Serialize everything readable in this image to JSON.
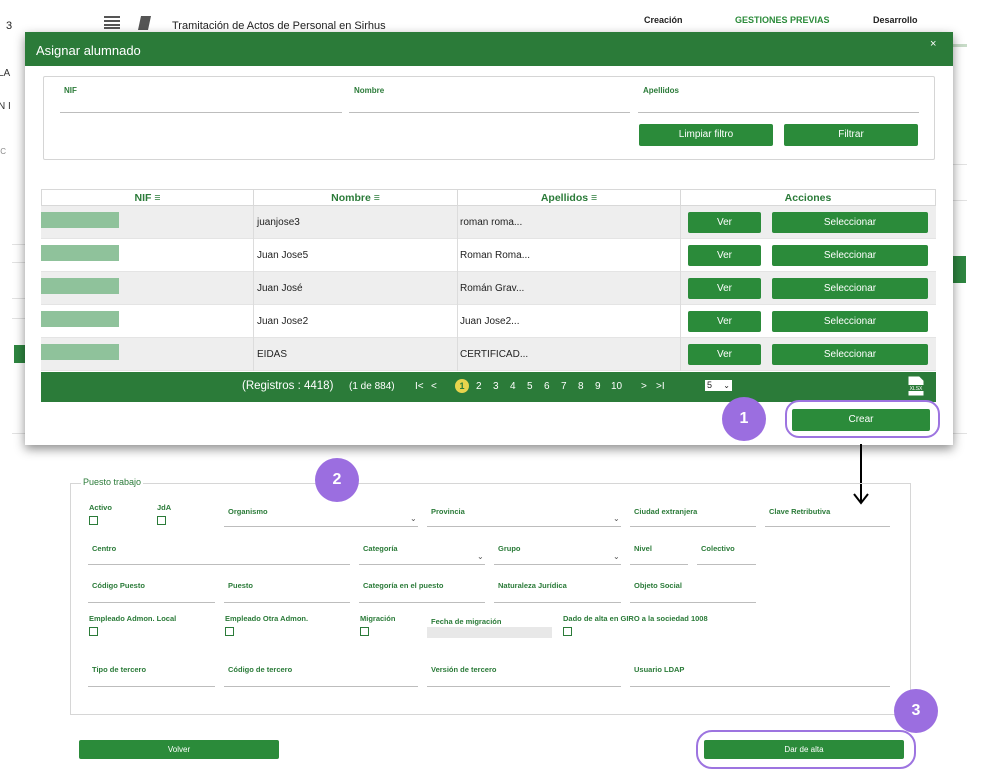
{
  "background": {
    "left_number": "3",
    "app_title": "Tramitación de Actos de Personal en Sirhus",
    "nav": [
      "Creación",
      "GESTIONES PREVIAS",
      "Desarrollo"
    ],
    "left_fragments": [
      "LA",
      "N I",
      "IC"
    ]
  },
  "modal": {
    "title": "Asignar alumnado",
    "close": "×",
    "filters": {
      "nif_label": "NIF",
      "nombre_label": "Nombre",
      "apellidos_label": "Apellidos",
      "clear_button": "Limpiar filtro",
      "filter_button": "Filtrar"
    },
    "table": {
      "headers": [
        "NIF",
        "Nombre",
        "Apellidos",
        "Acciones"
      ],
      "sort_icon": "≡",
      "rows": [
        {
          "nombre": "juanjose3",
          "apellidos": "roman roma..."
        },
        {
          "nombre": "Juan Jose5",
          "apellidos": "Roman Roma..."
        },
        {
          "nombre": "Juan José",
          "apellidos": "Román Grav..."
        },
        {
          "nombre": "Juan Jose2",
          "apellidos": "Juan Jose2..."
        },
        {
          "nombre": "EIDAS",
          "apellidos": "CERTIFICAD..."
        }
      ],
      "ver_label": "Ver",
      "select_label": "Seleccionar"
    },
    "pager": {
      "records": "(Registros : 4418)",
      "page_of": "(1 de 884)",
      "first": "I<",
      "prev": "<",
      "pages": [
        "1",
        "2",
        "3",
        "4",
        "5",
        "6",
        "7",
        "8",
        "9",
        "10"
      ],
      "next": ">",
      "last": ">I",
      "page_size": "5",
      "export_icon": "xlsx-export-icon"
    },
    "create_button": "Crear"
  },
  "annotations": [
    "1",
    "2",
    "3"
  ],
  "annotation_color": "#9b6ee0",
  "form": {
    "legend": "Puesto trabajo",
    "fields": {
      "activo": "Activo",
      "jda": "JdA",
      "organismo": "Organismo",
      "provincia": "Provincia",
      "ciudad_extranjera": "Ciudad extranjera",
      "clave_retributiva": "Clave Retributiva",
      "centro": "Centro",
      "categoria": "Categoría",
      "grupo": "Grupo",
      "nivel": "Nivel",
      "colectivo": "Colectivo",
      "codigo_puesto": "Código Puesto",
      "puesto": "Puesto",
      "categoria_puesto": "Categoría en el puesto",
      "naturaleza_juridica": "Naturaleza Jurídica",
      "objeto_social": "Objeto Social",
      "empleado_local": "Empleado Admon. Local",
      "empleado_otra": "Empleado Otra Admon.",
      "migracion": "Migración",
      "fecha_migracion": "Fecha de migración",
      "dado_alta": "Dado de alta en GIRO a la sociedad 1008",
      "tipo_tercero": "Tipo de tercero",
      "codigo_tercero": "Código de tercero",
      "version_tercero": "Versión de tercero",
      "usuario_ldap": "Usuario LDAP"
    },
    "back_button": "Volver",
    "submit_button": "Dar de alta"
  },
  "colors": {
    "primary": "#2b7b39",
    "accent": "#9b6ee0",
    "highlight": "#e8d44d"
  }
}
